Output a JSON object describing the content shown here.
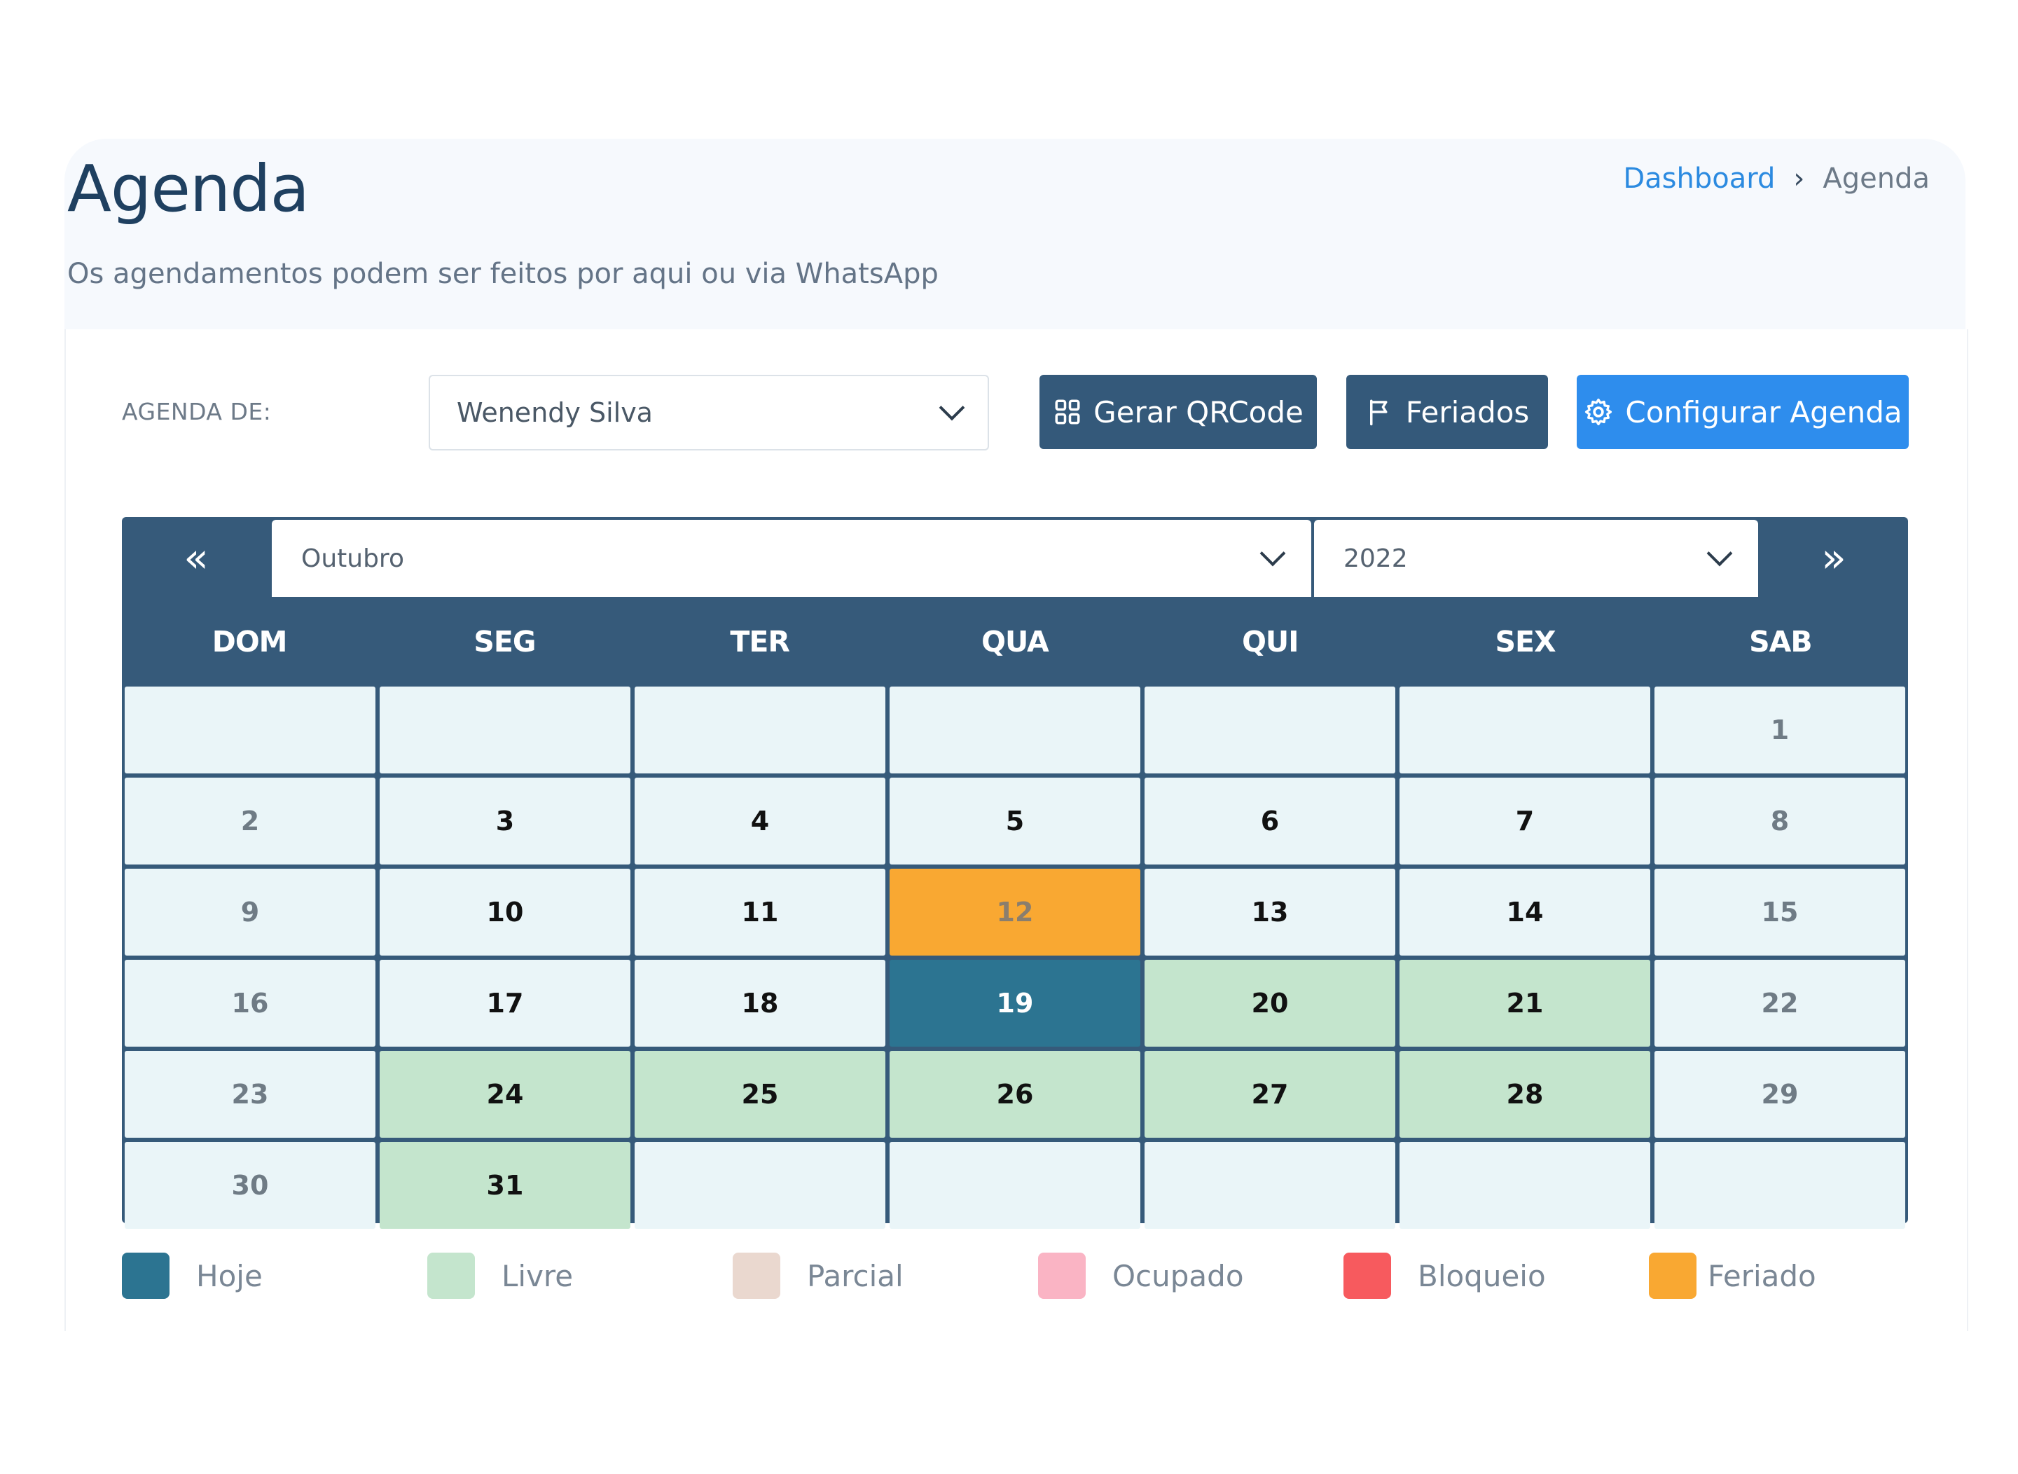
{
  "header": {
    "title": "Agenda",
    "subtitle": "Os agendamentos podem ser feitos por aqui ou via WhatsApp"
  },
  "breadcrumb": {
    "items": [
      "Dashboard",
      "Agenda"
    ],
    "separator": "›"
  },
  "toolbar": {
    "agenda_label": "AGENDA DE:",
    "agenda_select_value": "Wenendy Silva",
    "qrcode_label": "Gerar QRCode",
    "feriados_label": "Feriados",
    "configurar_label": "Configurar Agenda"
  },
  "calendar": {
    "prev_label": "«",
    "next_label": "»",
    "month": "Outubro",
    "year": "2022",
    "weekdays": [
      "DOM",
      "SEG",
      "TER",
      "QUA",
      "QUI",
      "SEX",
      "SAB"
    ],
    "days": [
      "",
      "",
      "",
      "",
      "",
      "",
      "1",
      "2",
      "3",
      "4",
      "5",
      "6",
      "7",
      "8",
      "9",
      "10",
      "11",
      "12",
      "13",
      "14",
      "15",
      "16",
      "17",
      "18",
      "19",
      "20",
      "21",
      "22",
      "23",
      "24",
      "25",
      "26",
      "27",
      "28",
      "29",
      "30",
      "31",
      "",
      "",
      "",
      "",
      ""
    ],
    "status": [
      "",
      "",
      "",
      "",
      "",
      "",
      "",
      "",
      "",
      "",
      "",
      "",
      "",
      "",
      "",
      "",
      "",
      "feriado",
      "",
      "",
      "",
      "",
      "",
      "",
      "hoje",
      "livre",
      "livre",
      "",
      "",
      "livre",
      "livre",
      "livre",
      "livre",
      "livre",
      "",
      "",
      "livre",
      "",
      "",
      "",
      "",
      ""
    ]
  },
  "legend": [
    {
      "label": "Hoje",
      "color": "#2c7491"
    },
    {
      "label": "Livre",
      "color": "#c4e5cd"
    },
    {
      "label": "Parcial",
      "color": "#ead8cf"
    },
    {
      "label": "Ocupado",
      "color": "#fab4c4"
    },
    {
      "label": "Bloqueio",
      "color": "#f75a5e"
    },
    {
      "label": "Feriado",
      "color": "#f9a832"
    }
  ],
  "colors": {
    "primary_dark": "#34597a",
    "primary_blue": "#2e8ded",
    "title": "#1f4060"
  }
}
